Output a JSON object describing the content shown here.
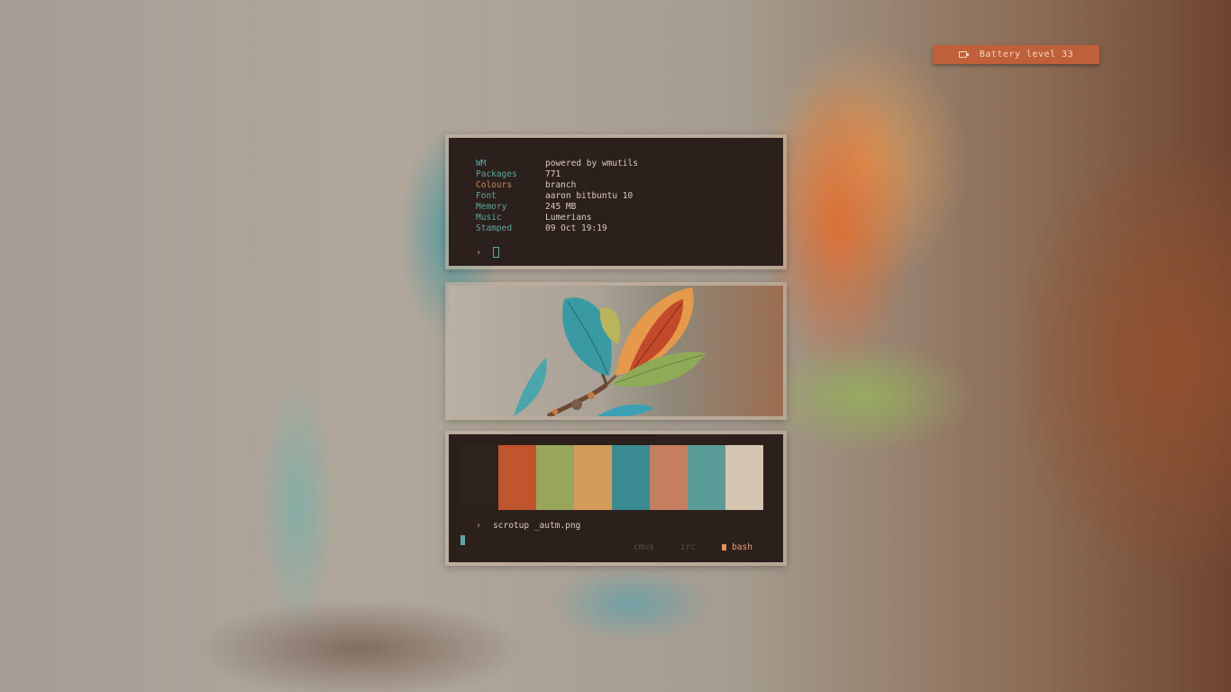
{
  "battery": {
    "icon": "battery-icon",
    "label": "Battery level 33"
  },
  "info_terminal": {
    "rows": [
      {
        "key": "WM",
        "value": "powered by wmutils"
      },
      {
        "key": "Packages",
        "value": "771"
      },
      {
        "key": "Colours",
        "value": "branch"
      },
      {
        "key": "Font",
        "value": "aaron bitbuntu 10"
      },
      {
        "key": "Memory",
        "value": "245 MB"
      },
      {
        "key": "Music",
        "value": "Lumerians"
      },
      {
        "key": "Stamped",
        "value": "09 Oct 19:19"
      }
    ],
    "prompt": "›"
  },
  "palette": {
    "swatches": [
      "#2d221e",
      "#c0552e",
      "#98a65c",
      "#d39b58",
      "#3a8b91",
      "#c57e5f",
      "#5a9c98",
      "#d3c5b0"
    ],
    "prompt": "›",
    "command": "scrotup _autm.png"
  },
  "tabs": [
    {
      "label": "cmus",
      "active": false
    },
    {
      "label": "irc",
      "active": false
    },
    {
      "label": "bash",
      "active": true
    }
  ],
  "colors": {
    "terminal_bg": "#2b201c",
    "accent_teal": "#5ba79e",
    "accent_orange": "#e7905a",
    "battery_bar": "#c0603a"
  }
}
